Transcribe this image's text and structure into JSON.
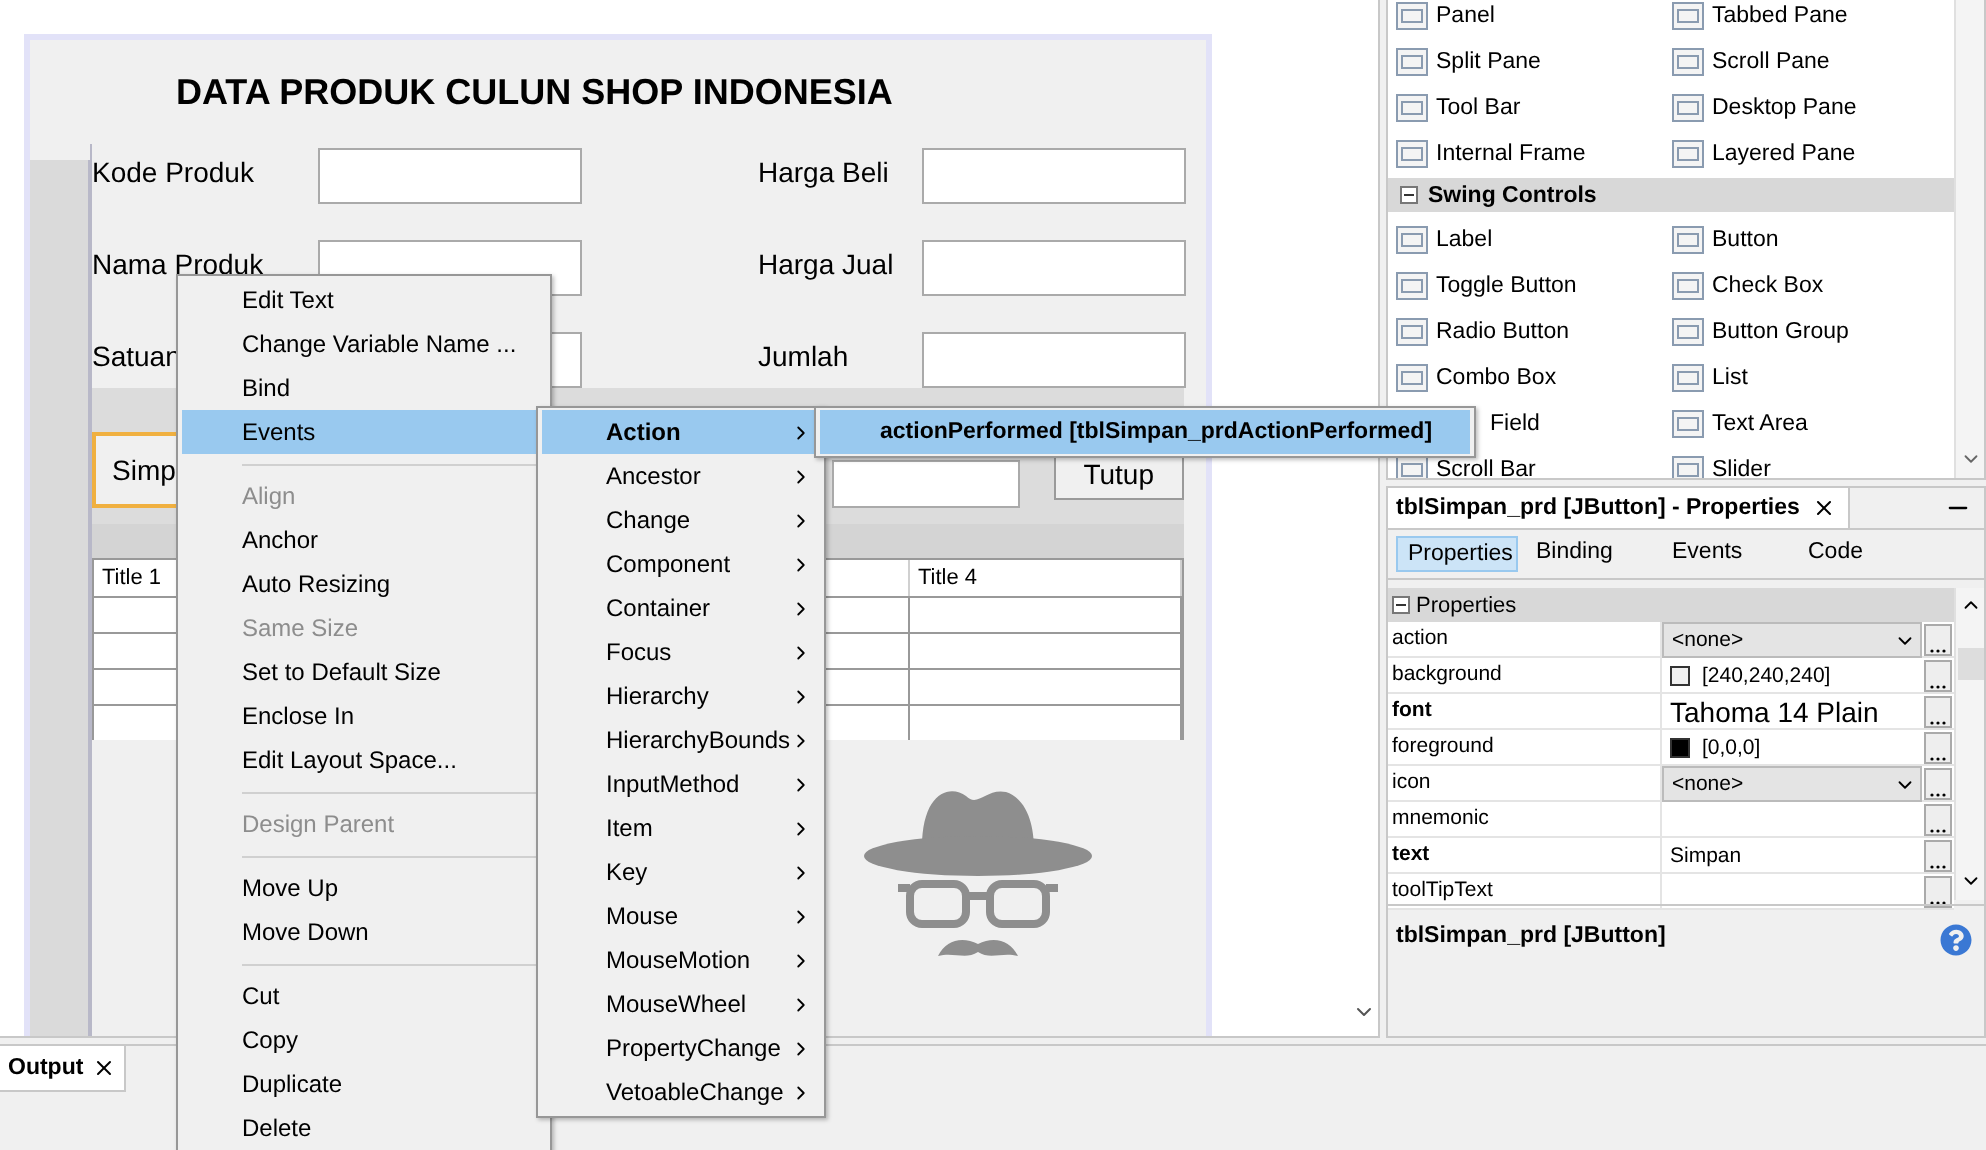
{
  "form": {
    "title": "DATA PRODUK CULUN SHOP INDONESIA",
    "rows": [
      {
        "left": "Kode Produk",
        "right": "Harga Beli"
      },
      {
        "left": "Nama Produk",
        "right": "Harga Jual"
      },
      {
        "left": "Satuan",
        "right": "Jumlah"
      }
    ],
    "buttons": [
      {
        "label": "Simp",
        "selected": true
      },
      {
        "label": "Tutup",
        "selected": false
      }
    ],
    "table": {
      "columns": [
        "Title 1",
        "Title 4"
      ]
    }
  },
  "context_menu": [
    {
      "kind": "item",
      "label": "Edit Text",
      "disabled": false,
      "selected": false
    },
    {
      "kind": "item",
      "label": "Change Variable Name ...",
      "disabled": false,
      "selected": false
    },
    {
      "kind": "item",
      "label": "Bind",
      "disabled": false,
      "selected": false
    },
    {
      "kind": "item",
      "label": "Events",
      "disabled": false,
      "selected": true
    },
    {
      "kind": "separator"
    },
    {
      "kind": "item",
      "label": "Align",
      "disabled": true,
      "selected": false
    },
    {
      "kind": "item",
      "label": "Anchor",
      "disabled": false,
      "selected": false
    },
    {
      "kind": "item",
      "label": "Auto Resizing",
      "disabled": false,
      "selected": false
    },
    {
      "kind": "item",
      "label": "Same Size",
      "disabled": true,
      "selected": false
    },
    {
      "kind": "item",
      "label": "Set to Default Size",
      "disabled": false,
      "selected": false
    },
    {
      "kind": "item",
      "label": "Enclose In",
      "disabled": false,
      "selected": false
    },
    {
      "kind": "item",
      "label": "Edit Layout Space...",
      "disabled": false,
      "selected": false
    },
    {
      "kind": "separator"
    },
    {
      "kind": "item",
      "label": "Design Parent",
      "disabled": true,
      "selected": false
    },
    {
      "kind": "separator"
    },
    {
      "kind": "item",
      "label": "Move Up",
      "disabled": false,
      "selected": false
    },
    {
      "kind": "item",
      "label": "Move Down",
      "disabled": false,
      "selected": false
    },
    {
      "kind": "separator"
    },
    {
      "kind": "item",
      "label": "Cut",
      "disabled": false,
      "selected": false
    },
    {
      "kind": "item",
      "label": "Copy",
      "disabled": false,
      "selected": false
    },
    {
      "kind": "item",
      "label": "Duplicate",
      "disabled": false,
      "selected": false
    },
    {
      "kind": "item",
      "label": "Delete",
      "disabled": false,
      "selected": false
    }
  ],
  "events_menu": [
    {
      "label": "Action",
      "selected": true
    },
    {
      "label": "Ancestor",
      "selected": false
    },
    {
      "label": "Change",
      "selected": false
    },
    {
      "label": "Component",
      "selected": false
    },
    {
      "label": "Container",
      "selected": false
    },
    {
      "label": "Focus",
      "selected": false
    },
    {
      "label": "Hierarchy",
      "selected": false
    },
    {
      "label": "HierarchyBounds",
      "selected": false
    },
    {
      "label": "InputMethod",
      "selected": false
    },
    {
      "label": "Item",
      "selected": false
    },
    {
      "label": "Key",
      "selected": false
    },
    {
      "label": "Mouse",
      "selected": false
    },
    {
      "label": "MouseMotion",
      "selected": false
    },
    {
      "label": "MouseWheel",
      "selected": false
    },
    {
      "label": "PropertyChange",
      "selected": false
    },
    {
      "label": "VetoableChange",
      "selected": false
    }
  ],
  "handler_menu": [
    {
      "label": "actionPerformed [tblSimpan_prdActionPerformed]",
      "selected": true
    }
  ],
  "palette": {
    "groups": [
      {
        "items": [
          "Panel",
          "Tabbed Pane",
          "Split Pane",
          "Scroll Pane",
          "Tool Bar",
          "Desktop Pane",
          "Internal Frame",
          "Layered Pane"
        ]
      },
      {
        "header": "Swing Controls",
        "items": [
          "Label",
          "Button",
          "Toggle Button",
          "Check Box",
          "Radio Button",
          "Button Group",
          "Combo Box",
          "List",
          {
            "label": "Field",
            "covered": true
          },
          "Text Area",
          "Scroll Bar",
          "Slider"
        ]
      }
    ]
  },
  "properties": {
    "title": "tblSimpan_prd [JButton] - Properties",
    "tabs": [
      {
        "label": "Properties",
        "selected": true
      },
      {
        "label": "Binding",
        "selected": false
      },
      {
        "label": "Events",
        "selected": false
      },
      {
        "label": "Code",
        "selected": false
      }
    ],
    "section": "Properties",
    "rows": [
      {
        "name": "action",
        "kind": "combo",
        "value": "<none>",
        "modified": false
      },
      {
        "name": "background",
        "kind": "color",
        "value": "[240,240,240]",
        "color": "#f0f0f0",
        "modified": false
      },
      {
        "name": "font",
        "kind": "font",
        "value": "Tahoma 14 Plain",
        "modified": true
      },
      {
        "name": "foreground",
        "kind": "color",
        "value": "[0,0,0]",
        "color": "#000000",
        "modified": false
      },
      {
        "name": "icon",
        "kind": "combo",
        "value": "<none>",
        "modified": false
      },
      {
        "name": "mnemonic",
        "kind": "text",
        "modified": false
      },
      {
        "name": "text",
        "kind": "text",
        "value": "Simpan",
        "modified": true
      },
      {
        "name": "toolTipText",
        "kind": "text",
        "modified": false
      }
    ],
    "description": "tblSimpan_prd [JButton]"
  },
  "output": {
    "tab": "Output"
  }
}
